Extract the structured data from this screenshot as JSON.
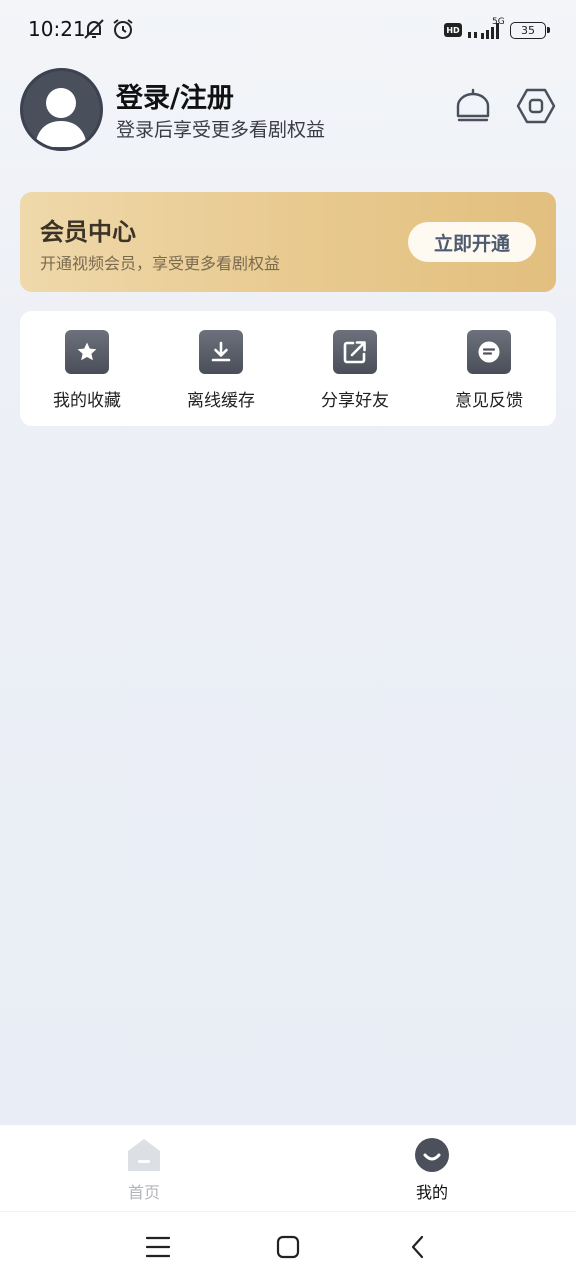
{
  "status_bar": {
    "time": "10:21",
    "hd": "HD",
    "network": "5G",
    "battery": "35"
  },
  "profile": {
    "title": "登录/注册",
    "subtitle": "登录后享受更多看剧权益"
  },
  "vip": {
    "title": "会员中心",
    "subtitle": "开通视频会员，享受更多看剧权益",
    "button_label": "立即开通"
  },
  "actions": [
    {
      "label": "我的收藏",
      "icon": "star-icon"
    },
    {
      "label": "离线缓存",
      "icon": "download-icon"
    },
    {
      "label": "分享好友",
      "icon": "share-icon"
    },
    {
      "label": "意见反馈",
      "icon": "feedback-icon"
    }
  ],
  "bottom_nav": {
    "home_label": "首页",
    "mine_label": "我的"
  },
  "colors": {
    "vip_gradient_start": "#efd8aa",
    "vip_gradient_end": "#e2bf7f",
    "icon_gray": "#555a65"
  }
}
